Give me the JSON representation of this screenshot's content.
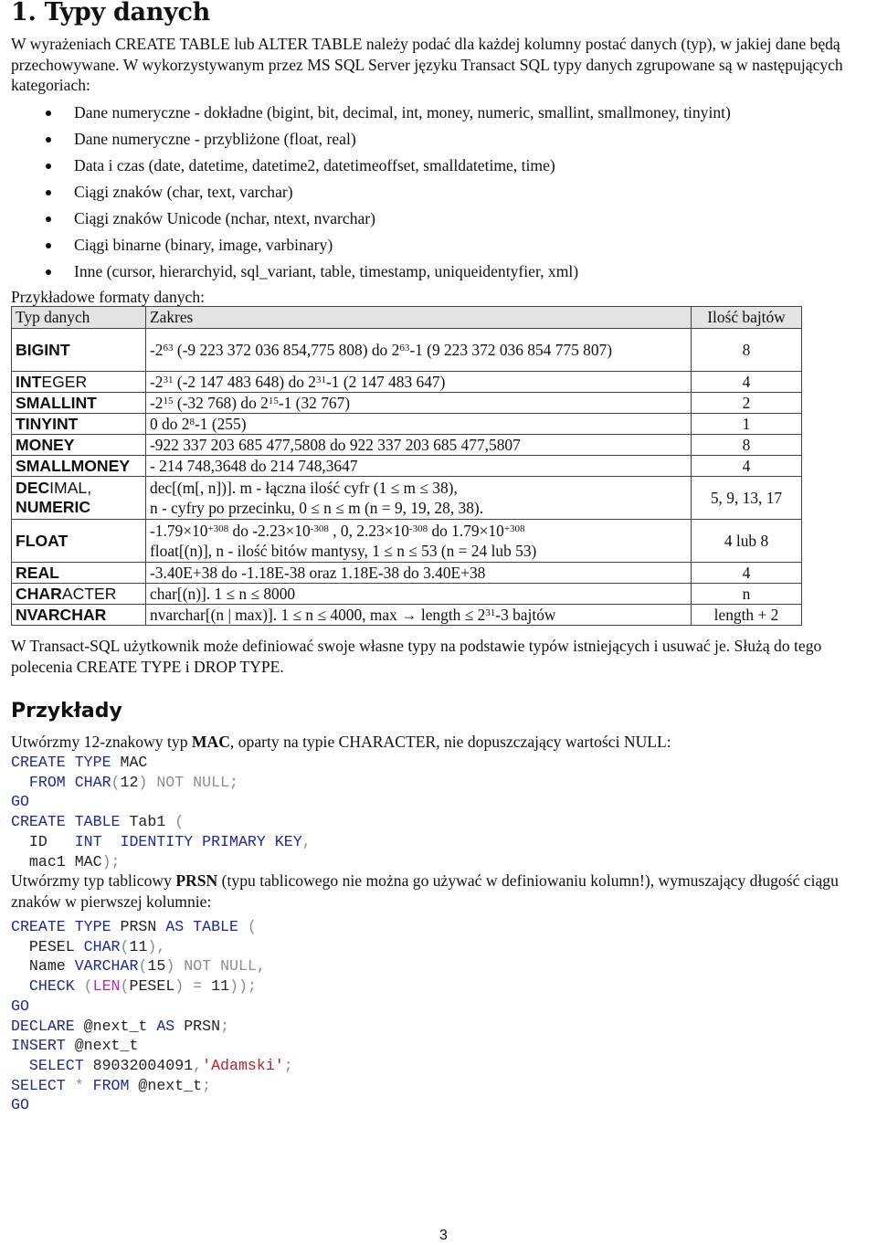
{
  "heading": "1. Typy danych",
  "intro": "W wyrażeniach CREATE TABLE lub ALTER TABLE należy podać dla każdej kolumny postać danych (typ), w jakiej dane będą przechowywane. W wykorzystywanym przez MS SQL Server języku Transact SQL typy danych zgrupowane są w następujących kategoriach:",
  "categories": [
    "Dane numeryczne - dokładne (bigint, bit, decimal, int, money, numeric, smallint, smallmoney, tinyint)",
    "Dane numeryczne - przybliżone (float, real)",
    "Data i czas (date, datetime, datetime2, datetimeoffset, smalldatetime, time)",
    "Ciągi znaków (char, text, varchar)",
    "Ciągi znaków Unicode (nchar, ntext, nvarchar)",
    "Ciągi binarne (binary, image, varbinary)",
    "Inne (cursor, hierarchyid, sql_variant, table, timestamp, uniqueidentyfier, xml)"
  ],
  "table_caption": "Przykładowe formaty danych:",
  "table": {
    "headers": [
      "Typ danych",
      "Zakres",
      "Ilość bajtów"
    ],
    "rows": [
      {
        "type_bold": "BIGINT",
        "type_rest": "",
        "type_line2": "",
        "range": [
          "-2",
          "63",
          " (-9 223 372 036 854,775 808) do 2",
          "63",
          "-1 (9 223 372 036 854 775 807)"
        ],
        "bytes": "8"
      },
      {
        "type_bold": "INT",
        "type_rest": "EGER",
        "type_line2": "",
        "range": [
          "-2",
          "31",
          " (-2 147 483 648) do 2",
          "31",
          "-1 (2 147 483 647)"
        ],
        "bytes": "4"
      },
      {
        "type_bold": "SMALLINT",
        "type_rest": "",
        "type_line2": "",
        "range": [
          "-2",
          "15",
          " (-32 768) do 2",
          "15",
          "-1 (32 767)"
        ],
        "bytes": "2"
      },
      {
        "type_bold": "TINYINT",
        "type_rest": "",
        "type_line2": "",
        "range": [
          "0 do 2",
          "8",
          "-1 (255)",
          "",
          ""
        ],
        "bytes": "1"
      },
      {
        "type_bold": "MONEY",
        "type_rest": "",
        "type_line2": "",
        "range": [
          "-922 337 203 685 477,5808 do 922 337 203 685 477,5807",
          "",
          "",
          "",
          ""
        ],
        "bytes": "8"
      },
      {
        "type_bold": "SMALLMONEY",
        "type_rest": "",
        "type_line2": "",
        "range": [
          "- 214 748,3648 do 214 748,3647",
          "",
          "",
          "",
          ""
        ],
        "bytes": "4"
      },
      {
        "type_bold": "DEC",
        "type_rest": "IMAL,",
        "type_line2": "NUMERIC",
        "range_lines": [
          "dec[(m[, n])]. m - łączna ilość cyfr (1 ≤ m ≤ 38),",
          "n - cyfry po przecinku, 0 ≤ n ≤ m (n = 9, 19, 28, 38)."
        ],
        "bytes": "5, 9, 13, 17"
      },
      {
        "type_bold": "FLOAT",
        "type_rest": "",
        "type_line2": "",
        "range_float": [
          "-1.79×10",
          "+308",
          " do -2.23×10",
          "-308",
          " , 0, 2.23×10",
          "-308",
          " do 1.79×10",
          "+308"
        ],
        "range_line2": "float[(n)], n - ilość bitów mantysy, 1 ≤ n ≤ 53 (n = 24 lub 53)",
        "bytes": "4 lub 8"
      },
      {
        "type_bold": "REAL",
        "type_rest": "",
        "type_line2": "",
        "range": [
          "-3.40E+38 do -1.18E-38 oraz 1.18E-38 do 3.40E+38",
          "",
          "",
          "",
          ""
        ],
        "bytes": "4"
      },
      {
        "type_bold": "CHAR",
        "type_rest": "ACTER",
        "type_line2": "",
        "range": [
          "char[(n)]. 1 ≤ n ≤ 8000",
          "",
          "",
          "",
          ""
        ],
        "bytes": "n"
      },
      {
        "type_bold": "NVARCHAR",
        "type_rest": "",
        "type_line2": "",
        "range": [
          "nvarchar[(n | max)]. 1 ≤ n ≤ 4000, max → length ≤ 2",
          "31",
          "-3 bajtów",
          "",
          ""
        ],
        "bytes": "length + 2"
      }
    ]
  },
  "udt_paragraph": "W Transact-SQL użytkownik może definiować swoje własne typy na podstawie typów istniejących i usuwać je. Służą do tego polecenia CREATE TYPE i DROP TYPE.",
  "examples_heading": "Przykłady",
  "example1": {
    "before": "Utwórzmy 12-znakowy typ ",
    "bold": "MAC",
    "after": ", oparty na typie CHARACTER, nie dopuszczający wartości NULL:"
  },
  "example2": {
    "before": "Utwórzmy typ tablicowy ",
    "bold": "PRSN",
    "after": " (typu tablicowego nie można go używać w definiowaniu kolumn!), wymuszający długość ciągu znaków w pierwszej kolumnie:"
  },
  "code1": [
    [
      [
        "kw",
        "CREATE TYPE"
      ],
      [
        "tx",
        " MAC"
      ]
    ],
    [
      [
        "tx",
        "  "
      ],
      [
        "kw",
        "FROM CHAR"
      ],
      [
        "gr",
        "("
      ],
      [
        "tx",
        "12"
      ],
      [
        "gr",
        ") NOT NULL;"
      ]
    ],
    [
      [
        "kw",
        "GO"
      ]
    ],
    [
      [
        "kw",
        "CREATE TABLE"
      ],
      [
        "tx",
        " Tab1 "
      ],
      [
        "gr",
        "("
      ]
    ],
    [
      [
        "tx",
        "  ID   "
      ],
      [
        "kw",
        "INT  IDENTITY PRIMARY KEY"
      ],
      [
        "gr",
        ","
      ]
    ],
    [
      [
        "tx",
        "  mac1 MAC"
      ],
      [
        "gr",
        ");"
      ]
    ]
  ],
  "code2": [
    [
      [
        "kw",
        "CREATE TYPE"
      ],
      [
        "tx",
        " PRSN "
      ],
      [
        "kw",
        "AS TABLE"
      ],
      [
        "gr",
        " ("
      ]
    ],
    [
      [
        "tx",
        "  PESEL "
      ],
      [
        "kw",
        "CHAR"
      ],
      [
        "gr",
        "("
      ],
      [
        "tx",
        "11"
      ],
      [
        "gr",
        "),"
      ]
    ],
    [
      [
        "tx",
        "  Name "
      ],
      [
        "kw",
        "VARCHAR"
      ],
      [
        "gr",
        "("
      ],
      [
        "tx",
        "15"
      ],
      [
        "gr",
        ") NOT NULL,"
      ]
    ],
    [
      [
        "tx",
        "  "
      ],
      [
        "kw",
        "CHECK"
      ],
      [
        "gr",
        " ("
      ],
      [
        "fn",
        "LEN"
      ],
      [
        "gr",
        "("
      ],
      [
        "tx",
        "PESEL"
      ],
      [
        "gr",
        ") = "
      ],
      [
        "tx",
        "11"
      ],
      [
        "gr",
        "));"
      ]
    ],
    [
      [
        "kw",
        "GO"
      ]
    ],
    [
      [
        "kw",
        "DECLARE"
      ],
      [
        "tx",
        " @next_t "
      ],
      [
        "kw",
        "AS"
      ],
      [
        "tx",
        " PRSN"
      ],
      [
        "gr",
        ";"
      ]
    ],
    [
      [
        "kw",
        "INSERT"
      ],
      [
        "tx",
        " @next_t"
      ]
    ],
    [
      [
        "tx",
        "  "
      ],
      [
        "kw",
        "SELECT"
      ],
      [
        "tx",
        " 89032004091"
      ],
      [
        "gr",
        ","
      ],
      [
        "str",
        "'Adamski'"
      ],
      [
        "gr",
        ";"
      ]
    ],
    [
      [
        "kw",
        "SELECT"
      ],
      [
        "gr",
        " * "
      ],
      [
        "kw",
        "FROM"
      ],
      [
        "tx",
        " @next_t"
      ],
      [
        "gr",
        ";"
      ]
    ],
    [
      [
        "kw",
        "GO"
      ]
    ]
  ],
  "page_number": "3",
  "colors": {
    "keyword": "#1e2b8f",
    "operator": "#8d8d8d",
    "function": "#b42cb4",
    "string": "#b0232a",
    "table_header_bg": "#e3e3e3"
  }
}
